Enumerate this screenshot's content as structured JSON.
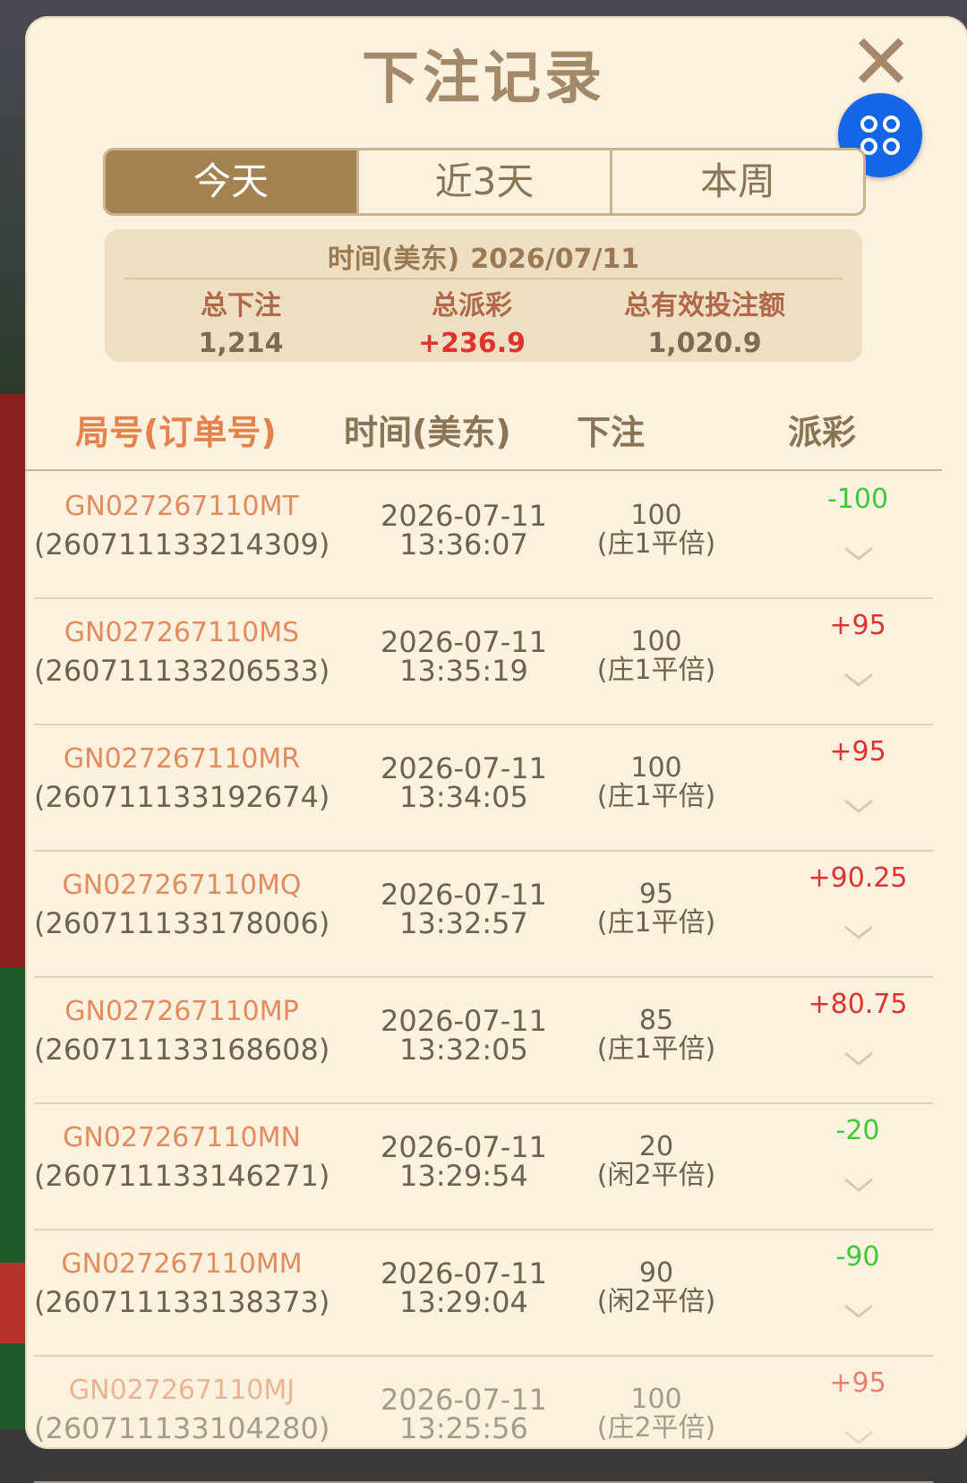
{
  "title": "下注记录",
  "tabs": [
    {
      "label": "今天",
      "active": true
    },
    {
      "label": "近3天",
      "active": false
    },
    {
      "label": "本周",
      "active": false
    }
  ],
  "summary": {
    "date_label": "时间(美东)",
    "date": "2026/07/11",
    "total_bet_label": "总下注",
    "total_bet": "1,214",
    "total_payout_label": "总派彩",
    "total_payout": "+236.9",
    "total_valid_label": "总有效投注额",
    "total_valid": "1,020.9"
  },
  "columns": [
    "局号(订单号)",
    "时间(美东)",
    "下注",
    "派彩"
  ],
  "rows": [
    {
      "game": "GN027267110MT",
      "order": "(260711133214309)",
      "date": "2026-07-11",
      "time": "13:36:07",
      "bet": "100",
      "bet_type": "(庄1平倍)",
      "payout": "-100",
      "payout_sign": "neg"
    },
    {
      "game": "GN027267110MS",
      "order": "(260711133206533)",
      "date": "2026-07-11",
      "time": "13:35:19",
      "bet": "100",
      "bet_type": "(庄1平倍)",
      "payout": "+95",
      "payout_sign": "pos"
    },
    {
      "game": "GN027267110MR",
      "order": "(260711133192674)",
      "date": "2026-07-11",
      "time": "13:34:05",
      "bet": "100",
      "bet_type": "(庄1平倍)",
      "payout": "+95",
      "payout_sign": "pos"
    },
    {
      "game": "GN027267110MQ",
      "order": "(260711133178006)",
      "date": "2026-07-11",
      "time": "13:32:57",
      "bet": "95",
      "bet_type": "(庄1平倍)",
      "payout": "+90.25",
      "payout_sign": "pos"
    },
    {
      "game": "GN027267110MP",
      "order": "(260711133168608)",
      "date": "2026-07-11",
      "time": "13:32:05",
      "bet": "85",
      "bet_type": "(庄1平倍)",
      "payout": "+80.75",
      "payout_sign": "pos"
    },
    {
      "game": "GN027267110MN",
      "order": "(260711133146271)",
      "date": "2026-07-11",
      "time": "13:29:54",
      "bet": "20",
      "bet_type": "(闲2平倍)",
      "payout": "-20",
      "payout_sign": "neg"
    },
    {
      "game": "GN027267110MM",
      "order": "(260711133138373)",
      "date": "2026-07-11",
      "time": "13:29:04",
      "bet": "90",
      "bet_type": "(闲2平倍)",
      "payout": "-90",
      "payout_sign": "neg"
    },
    {
      "game": "GN027267110MJ",
      "order": "(260711133104280)",
      "date": "2026-07-11",
      "time": "13:25:56",
      "bet": "100",
      "bet_type": "(庄2平倍)",
      "payout": "+95",
      "payout_sign": "pos"
    }
  ],
  "colors": {
    "accent": "#a3824f",
    "positive": "#e0322e",
    "negative": "#3fc83a",
    "fab": "#1565e8"
  },
  "icons": {
    "close": "close-icon",
    "menu": "grid-menu-icon",
    "expand": "chevron-down-icon"
  }
}
